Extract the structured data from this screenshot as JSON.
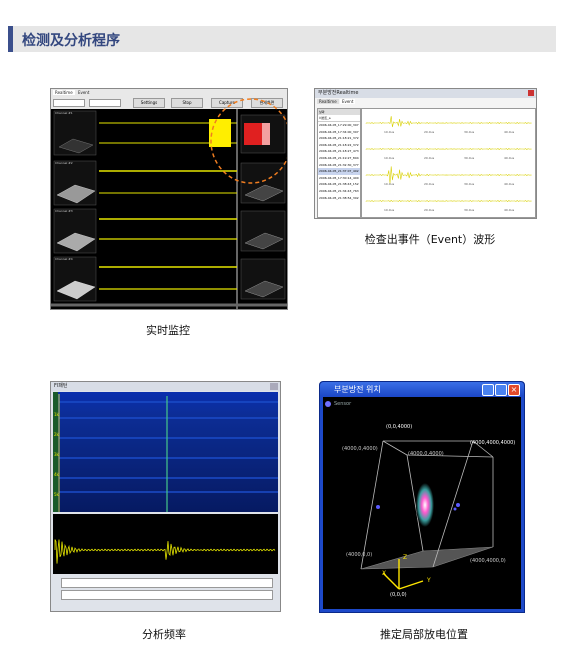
{
  "header": {
    "title": "检测及分析程序"
  },
  "captions": {
    "realtime": "实时监控",
    "event": "检查出事件（Event）波形",
    "frequency": "分析频率",
    "location": "推定局部放电位置"
  },
  "realtime_app": {
    "tabs": [
      "Realtime",
      "Event"
    ],
    "buttons": [
      "Settings",
      "Stop",
      "Capture",
      "현재화면"
    ],
    "channels": [
      "Channel #1",
      "Channel #2",
      "Channel #3",
      "Channel #4"
    ]
  },
  "event_app": {
    "title": "부분방전Realtime",
    "tabs": [
      "Realtime",
      "Event"
    ],
    "list_header": "날짜",
    "list_sub": "이벤트_a",
    "events": [
      "2006-04-05_17:29:00_307",
      "2006-04-05_17:34:00_307",
      "2006-04-05_21:18:21_372",
      "2006-04-05_21:18:22_372",
      "2006-04-05_21:18:27_473",
      "2006-04-05_21:19:27_804",
      "2006-04-05_21:32:30_377",
      "2006-04-05_21:37:07_402",
      "2006-04-05_17:30:14_400",
      "2006-04-05_21:38:43_152",
      "2006-04-05_21:34:43_763",
      "2006-04-05_21:38:54_302"
    ],
    "axis_ticks": [
      "10.0us",
      "20.0us",
      "30.0us",
      "40.0us"
    ]
  },
  "freq_app": {
    "title": "Fl패턴",
    "ticks": [
      "1k",
      "2k",
      "3k",
      "4k",
      "5k"
    ]
  },
  "location_app": {
    "title": "부분방전 위치",
    "legend": "Sensor",
    "labels": [
      "(0,0,4000)",
      "(4000,0,4000)",
      "(4000,0,4000)",
      "(4000,4000,4000)",
      "(4000,0,0)",
      "(4000,4000,0)",
      "(0,0,0)"
    ],
    "axes": [
      "X",
      "Y",
      "Z"
    ]
  },
  "colors": {
    "header_accent": "#3b4f8c",
    "header_text": "#33477f",
    "waveform": "#e6e600",
    "spectrum_bg": "#0c2a8a",
    "scene_bg": "#000000",
    "window_frame": "#1d49c9"
  }
}
